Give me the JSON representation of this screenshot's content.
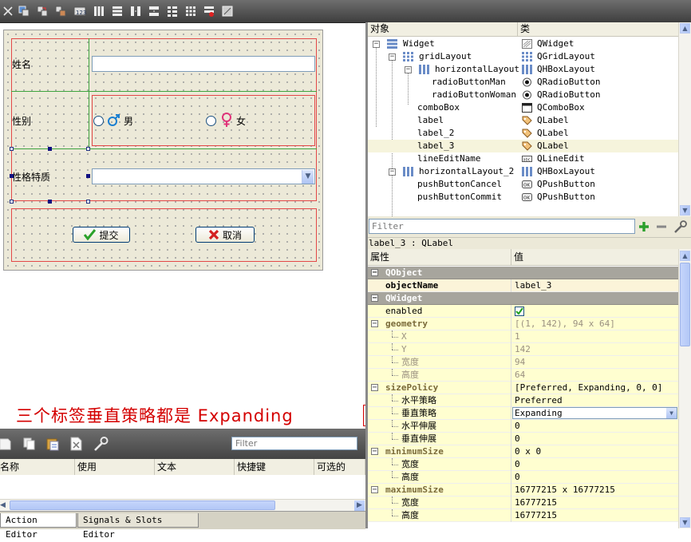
{
  "form": {
    "labels": {
      "name": "姓名",
      "gender": "性别",
      "personality": "性格特质"
    },
    "radio_man_label": "男",
    "radio_woman_label": "女",
    "name_value": "",
    "combo_value": "",
    "submit_label": "提交",
    "cancel_label": "取消"
  },
  "annotation": {
    "text": "三个标签垂直策略都是 Expanding"
  },
  "object_inspector": {
    "headers": [
      "对象",
      "类"
    ],
    "rows": [
      {
        "name": "Widget",
        "cls": "QWidget"
      },
      {
        "name": "gridLayout",
        "cls": "QGridLayout"
      },
      {
        "name": "horizontalLayout",
        "cls": "QHBoxLayout"
      },
      {
        "name": "radioButtonMan",
        "cls": "QRadioButton"
      },
      {
        "name": "radioButtonWoman",
        "cls": "QRadioButton"
      },
      {
        "name": "comboBox",
        "cls": "QComboBox"
      },
      {
        "name": "label",
        "cls": "QLabel"
      },
      {
        "name": "label_2",
        "cls": "QLabel"
      },
      {
        "name": "label_3",
        "cls": "QLabel"
      },
      {
        "name": "lineEditName",
        "cls": "QLineEdit"
      },
      {
        "name": "horizontalLayout_2",
        "cls": "QHBoxLayout"
      },
      {
        "name": "pushButtonCancel",
        "cls": "QPushButton"
      },
      {
        "name": "pushButtonCommit",
        "cls": "QPushButton"
      }
    ]
  },
  "filter": {
    "placeholder": "Filter"
  },
  "selected_object": "label_3 : QLabel",
  "property_editor": {
    "headers": [
      "属性",
      "值"
    ],
    "rows": [
      {
        "name": "QObject",
        "value": "",
        "type": "group"
      },
      {
        "name": "objectName",
        "value": "label_3",
        "type": "prop"
      },
      {
        "name": "QWidget",
        "value": "",
        "type": "group"
      },
      {
        "name": "enabled",
        "value": "",
        "type": "check"
      },
      {
        "name": "geometry",
        "value": "[(1, 142), 94 x 64]",
        "type": "expand"
      },
      {
        "name": "X",
        "value": "1",
        "type": "sub"
      },
      {
        "name": "Y",
        "value": "142",
        "type": "sub"
      },
      {
        "name": "宽度",
        "value": "94",
        "type": "sub"
      },
      {
        "name": "高度",
        "value": "64",
        "type": "sub"
      },
      {
        "name": "sizePolicy",
        "value": "[Preferred, Expanding, 0, 0]",
        "type": "expand"
      },
      {
        "name": "水平策略",
        "value": "Preferred",
        "type": "sub"
      },
      {
        "name": "垂直策略",
        "value": "Expanding",
        "type": "combo"
      },
      {
        "name": "水平伸展",
        "value": "0",
        "type": "sub"
      },
      {
        "name": "垂直伸展",
        "value": "0",
        "type": "sub"
      },
      {
        "name": "minimumSize",
        "value": "0 x 0",
        "type": "expand"
      },
      {
        "name": "宽度",
        "value": "0",
        "type": "sub"
      },
      {
        "name": "高度",
        "value": "0",
        "type": "sub"
      },
      {
        "name": "maximumSize",
        "value": "16777215 x 16777215",
        "type": "expand"
      },
      {
        "name": "宽度",
        "value": "16777215",
        "type": "sub"
      },
      {
        "name": "高度",
        "value": "16777215",
        "type": "sub"
      }
    ]
  },
  "action_editor": {
    "filter_placeholder": "Filter",
    "columns": [
      "名称",
      "使用",
      "文本",
      "快捷键",
      "可选的"
    ],
    "tabs": [
      "Action Editor",
      "Signals & Slots Editor"
    ]
  }
}
